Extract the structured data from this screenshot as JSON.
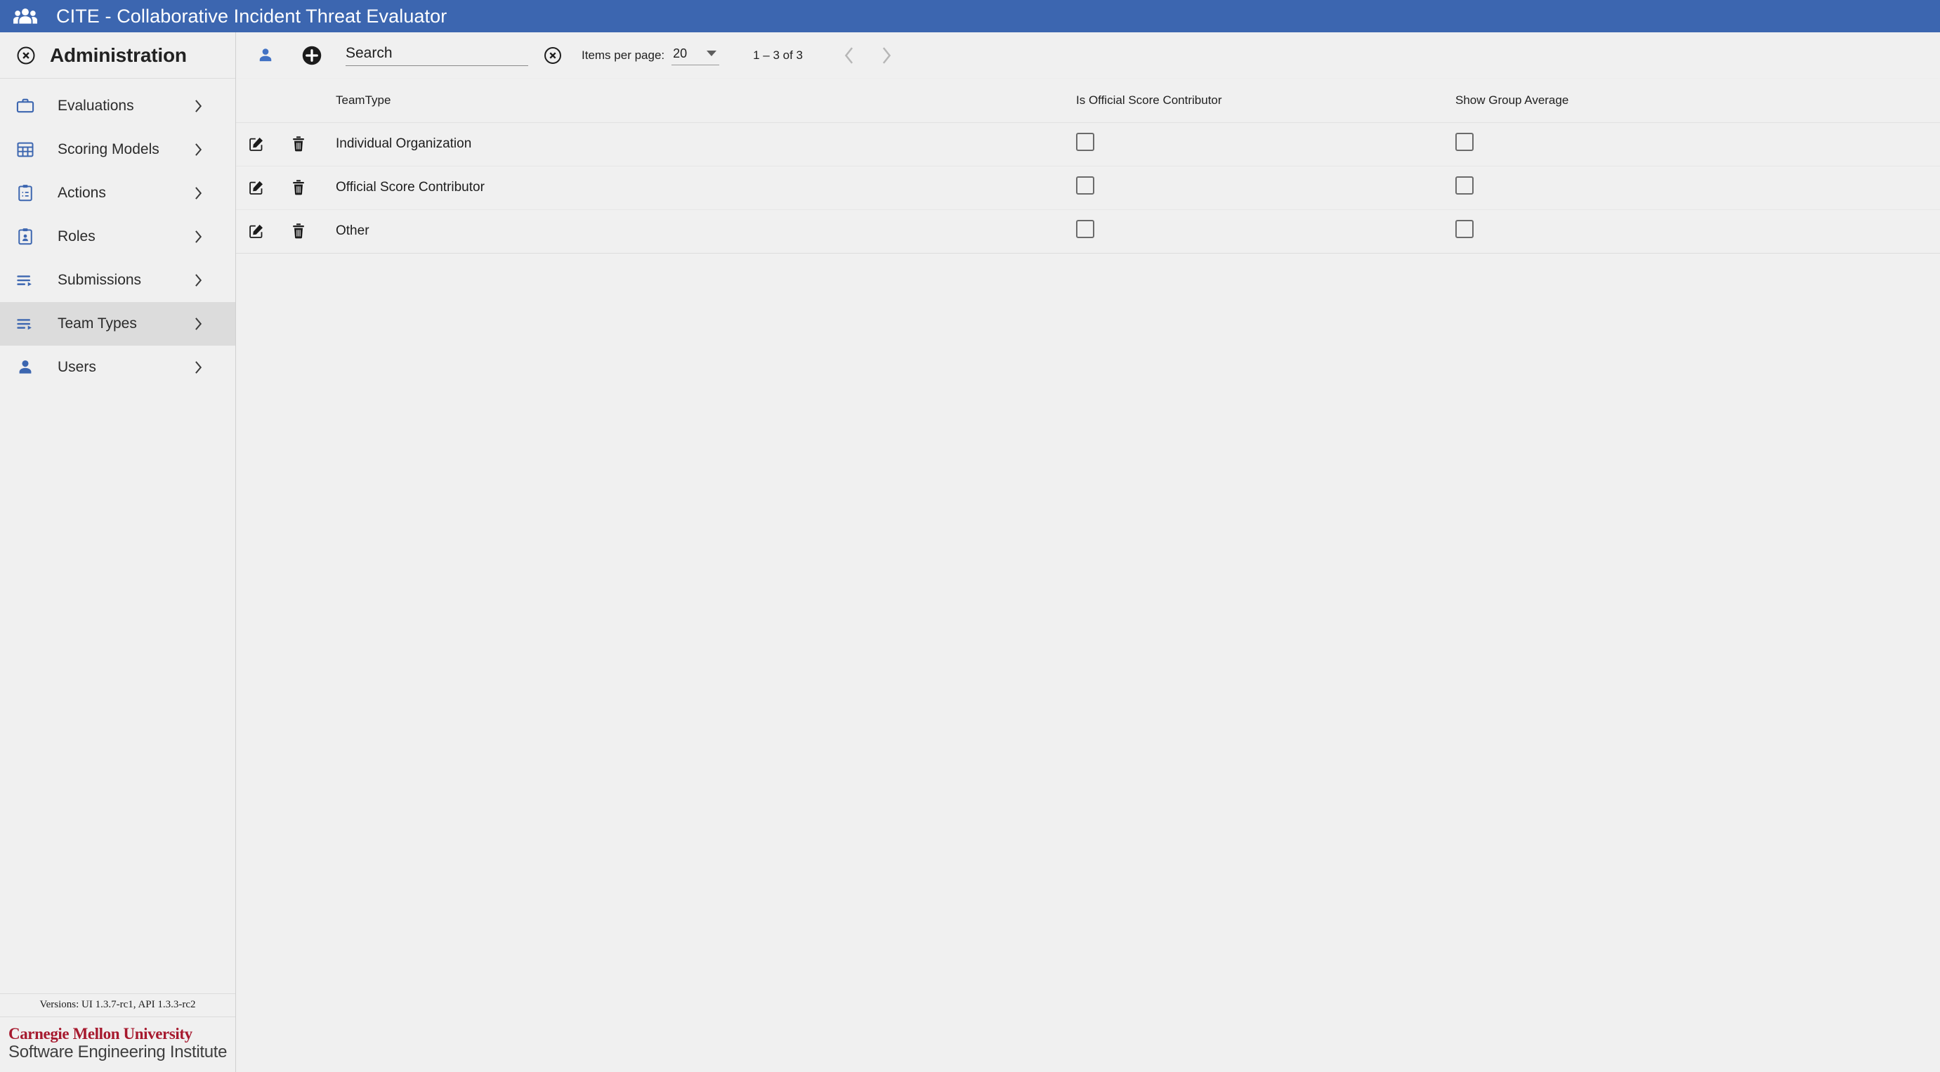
{
  "app": {
    "logo_icon": "group-people-icon",
    "title": "CITE - Collaborative Incident Threat Evaluator",
    "header_color": "#3c66b0"
  },
  "sidebar": {
    "header": {
      "close_icon": "close-circle-icon",
      "title": "Administration"
    },
    "items": [
      {
        "label": "Evaluations",
        "icon": "briefcase-icon",
        "chevron": "›",
        "active": false
      },
      {
        "label": "Scoring Models",
        "icon": "grid-table-icon",
        "chevron": "›",
        "active": false
      },
      {
        "label": "Actions",
        "icon": "clipboard-list-icon",
        "chevron": "›",
        "active": false
      },
      {
        "label": "Roles",
        "icon": "clipboard-user-icon",
        "chevron": "›",
        "active": false
      },
      {
        "label": "Submissions",
        "icon": "playlist-play-icon",
        "chevron": "›",
        "active": false
      },
      {
        "label": "Team Types",
        "icon": "playlist-play-icon",
        "chevron": "›",
        "active": true
      },
      {
        "label": "Users",
        "icon": "person-icon",
        "chevron": "›",
        "active": false
      }
    ],
    "versions": "Versions: UI 1.3.7-rc1, API 1.3.3-rc2",
    "logo": {
      "line1": "Carnegie Mellon University",
      "line2": "Software Engineering Institute",
      "line1_color": "#a6192e",
      "line2_color": "#3f3f3f"
    },
    "active_highlight_color": "#dcdcdc",
    "icon_color": "#3c66b0"
  },
  "toolbar": {
    "person_add_icon": "person-add-icon",
    "add_icon": "add-circle-icon",
    "search": {
      "placeholder": "Search",
      "value": ""
    },
    "clear_icon": "clear-circle-icon",
    "items_per_page_label": "Items per page:",
    "page_size_value": "20",
    "page_size_options": [
      "20"
    ],
    "range_label": "1 – 3 of 3",
    "prev_icon": "chevron-left-icon",
    "next_icon": "chevron-right-icon",
    "prev_disabled": true,
    "next_disabled": true
  },
  "table": {
    "columns": [
      "",
      "",
      "TeamType",
      "Is Official Score Contributor",
      "Show Group Average",
      ""
    ],
    "headers": {
      "team_type": "TeamType",
      "is_official_score_contributor": "Is Official Score Contributor",
      "show_group_average": "Show Group Average"
    },
    "row_icons": {
      "edit": "edit-pencil-square-icon",
      "delete": "trash-icon"
    },
    "rows": [
      {
        "team_type": "Individual Organization",
        "is_official_score_contributor": false,
        "show_group_average": false
      },
      {
        "team_type": "Official Score Contributor",
        "is_official_score_contributor": false,
        "show_group_average": false
      },
      {
        "team_type": "Other",
        "is_official_score_contributor": false,
        "show_group_average": false
      }
    ]
  }
}
